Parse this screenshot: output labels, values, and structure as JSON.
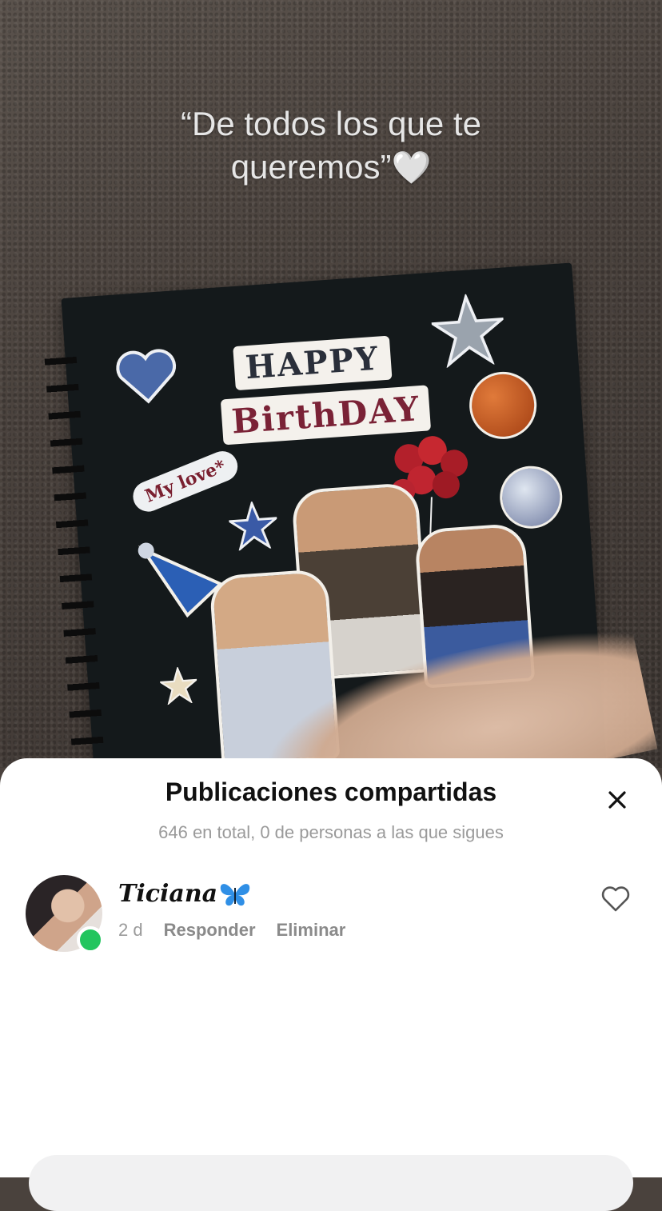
{
  "video": {
    "caption_line1": "“De todos los que te",
    "caption_line2": "queremos”",
    "caption_emoji": "🤍",
    "sticker_happy": "HAPPY",
    "sticker_birthday": "BirthDAY",
    "sticker_mylove": "My love*"
  },
  "sheet": {
    "title": "Publicaciones compartidas",
    "subtitle": "646 en total, 0 de personas a las que sigues",
    "close_icon": "close-icon",
    "items": [
      {
        "username": "Ticiana",
        "emoji_icon": "butterfly-icon",
        "time": "2 d",
        "reply_label": "Responder",
        "delete_label": "Eliminar",
        "online": true,
        "liked": false
      }
    ]
  },
  "colors": {
    "online": "#22c55e",
    "muted_text": "#9a9a9a",
    "sheet_bg": "#ffffff"
  }
}
